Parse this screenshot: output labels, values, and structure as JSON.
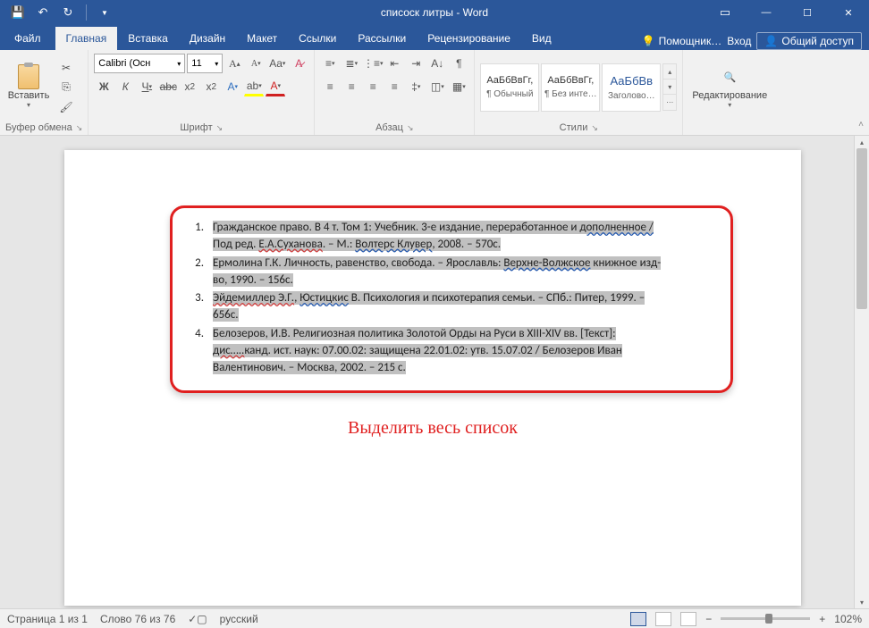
{
  "titlebar": {
    "title": "списоск литры - Word"
  },
  "tabs": {
    "file": "Файл",
    "home": "Главная",
    "insert": "Вставка",
    "design": "Дизайн",
    "layout": "Макет",
    "references": "Ссылки",
    "mailings": "Рассылки",
    "review": "Рецензирование",
    "view": "Вид",
    "helper": "Помощник…",
    "signin": "Вход",
    "share": "Общий доступ"
  },
  "ribbon": {
    "clipboard": {
      "label": "Буфер обмена",
      "paste": "Вставить"
    },
    "font": {
      "label": "Шрифт",
      "name": "Calibri (Осн",
      "size": "11",
      "bold": "Ж",
      "italic": "К",
      "underline": "Ч",
      "strike": "abc",
      "aa": "Aa"
    },
    "paragraph": {
      "label": "Абзац"
    },
    "styles": {
      "label": "Стили",
      "preview": "АаБбВвГг,",
      "preview_heading": "АаБбВв",
      "normal": "¶ Обычный",
      "nospacing": "¶ Без инте…",
      "heading1": "Заголово…"
    },
    "editing": {
      "label": "Редактирование"
    }
  },
  "document": {
    "items": [
      "Гражданское право. В 4 т. Том 1: Учебник. 3-е издание, переработанное и дополненное / Под ред. Е.А.Суханова. – М.: Волтерс Клувер, 2008. – 570с.",
      "Ермолина Г.К. Личность, равенство, свобода. – Ярославль: Верхне-Волжское книжное изд-во, 1990. – 156с.",
      "Эйдемиллер Э.Г., Юстицкис В. Психология и психотерапия семьи. – СПб.: Питер, 1999. – 656с.",
      "Белозеров, И.В. Религиозная политика Золотой Орды на Руси в XIII-XIV вв. [Текст]: дис…..канд. ист. наук: 07.00.02: защищена 22.01.02: утв. 15.07.02 / Белозеров Иван Валентинович. – Москва, 2002. – 215 с."
    ],
    "caption": "Выделить весь список"
  },
  "statusbar": {
    "page": "Страница 1 из 1",
    "words": "Слово 76 из 76",
    "lang": "русский",
    "zoom": "102%"
  }
}
